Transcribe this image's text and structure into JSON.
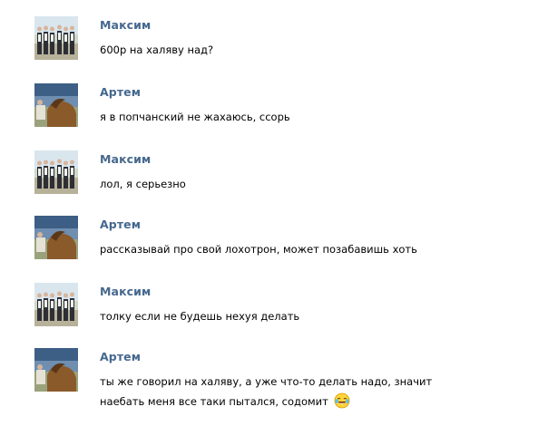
{
  "conversation": {
    "messages": [
      {
        "author": "Максим",
        "avatar": "group-photo-avatar",
        "text": "600р на халяву над?"
      },
      {
        "author": "Артем",
        "avatar": "horse-photo-avatar",
        "text": "я в попчанский не жахаюсь, ссорь"
      },
      {
        "author": "Максим",
        "avatar": "group-photo-avatar",
        "text": "лол, я серьезно"
      },
      {
        "author": "Артем",
        "avatar": "horse-photo-avatar",
        "text": "рассказывай про свой лохотрон, может позабавишь хоть"
      },
      {
        "author": "Максим",
        "avatar": "group-photo-avatar",
        "text": "толку если не будешь нехуя делать"
      },
      {
        "author": "Артем",
        "avatar": "horse-photo-avatar",
        "text": "ты же говорил на халяву, а уже что-то делать надо, значит\nнаебать меня все таки пытался, содомит",
        "emoji": "laughing-tears-emoji"
      }
    ]
  },
  "colors": {
    "author_name": "#45688e",
    "message_text": "#000000",
    "background": "#ffffff"
  }
}
